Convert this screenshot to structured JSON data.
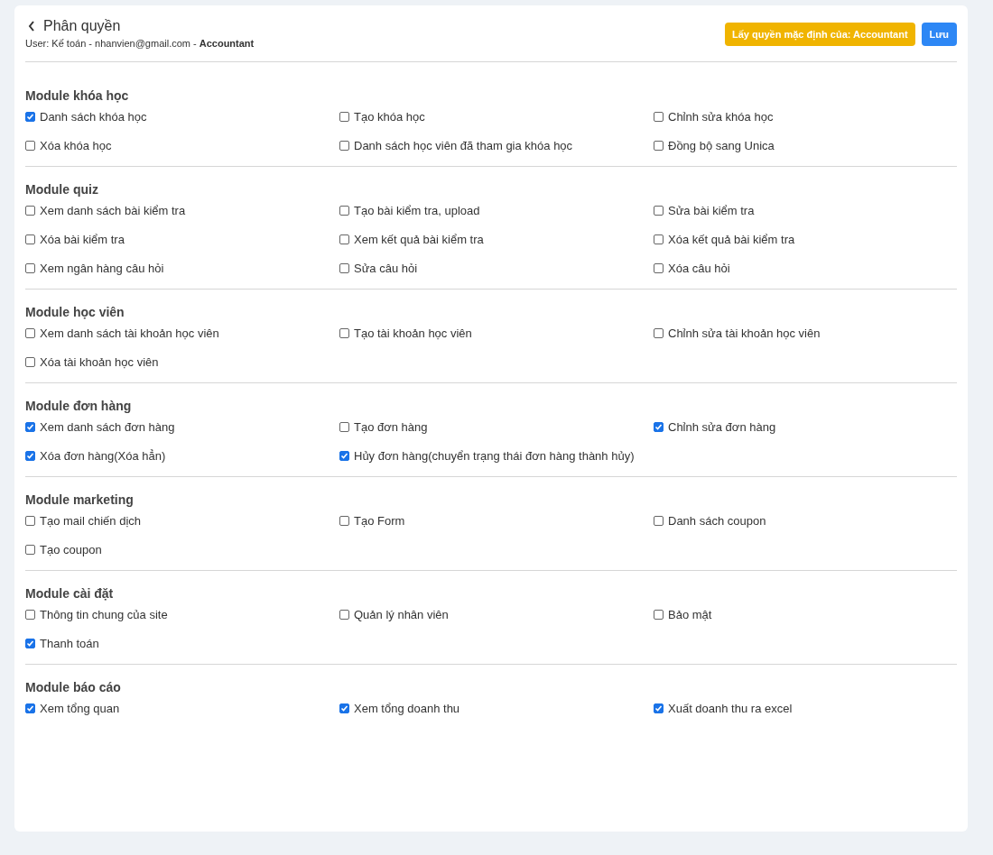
{
  "header": {
    "title": "Phân quyền",
    "subtitle": "User: Kế toán - nhanvien@gmail.com - **Accountant**",
    "buttons": [
      {
        "label": "Lấy quyền mặc định của: Accountant",
        "kind": "warning"
      },
      {
        "label": "Lưu",
        "kind": "primary"
      }
    ]
  },
  "modules": [
    {
      "title": "Module khóa học",
      "permissions": [
        {
          "label": "Danh sách khóa học",
          "checked": true
        },
        {
          "label": "Tạo khóa học",
          "checked": false
        },
        {
          "label": "Chỉnh sửa khóa học",
          "checked": false
        },
        {
          "label": "Xóa khóa học",
          "checked": false
        },
        {
          "label": "Danh sách học viên đã tham gia khóa học",
          "checked": false
        },
        {
          "label": "Đồng bộ sang Unica",
          "checked": false
        }
      ]
    },
    {
      "title": "Module quiz",
      "permissions": [
        {
          "label": "Xem danh sách bài kiểm tra",
          "checked": false
        },
        {
          "label": "Tạo bài kiểm tra, upload",
          "checked": false
        },
        {
          "label": "Sửa bài kiểm tra",
          "checked": false
        },
        {
          "label": "Xóa bài kiểm tra",
          "checked": false
        },
        {
          "label": "Xem kết quả bài kiểm tra",
          "checked": false
        },
        {
          "label": "Xóa kết quả bài kiểm tra",
          "checked": false
        },
        {
          "label": "Xem ngân hàng câu hỏi",
          "checked": false
        },
        {
          "label": "Sửa câu hỏi",
          "checked": false
        },
        {
          "label": "Xóa câu hỏi",
          "checked": false
        }
      ]
    },
    {
      "title": "Module học viên",
      "permissions": [
        {
          "label": "Xem danh sách tài khoản học viên",
          "checked": false
        },
        {
          "label": "Tạo tài khoản học viên",
          "checked": false
        },
        {
          "label": "Chỉnh sửa tài khoản học viên",
          "checked": false
        },
        {
          "label": "Xóa tài khoản học viên",
          "checked": false
        }
      ]
    },
    {
      "title": "Module đơn hàng",
      "permissions": [
        {
          "label": "Xem danh sách đơn hàng",
          "checked": true
        },
        {
          "label": "Tạo đơn hàng",
          "checked": false
        },
        {
          "label": "Chỉnh sửa đơn hàng",
          "checked": true
        },
        {
          "label": "Xóa đơn hàng(Xóa hẳn)",
          "checked": true
        },
        {
          "label": "Hủy đơn hàng(chuyển trạng thái đơn hàng thành hủy)",
          "checked": true
        }
      ]
    },
    {
      "title": "Module marketing",
      "permissions": [
        {
          "label": "Tạo mail chiến dịch",
          "checked": false
        },
        {
          "label": "Tạo Form",
          "checked": false
        },
        {
          "label": "Danh sách coupon",
          "checked": false
        },
        {
          "label": "Tạo coupon",
          "checked": false
        }
      ]
    },
    {
      "title": "Module cài đặt",
      "permissions": [
        {
          "label": "Thông tin chung của site",
          "checked": false
        },
        {
          "label": "Quản lý nhân viên",
          "checked": false
        },
        {
          "label": "Bảo mật",
          "checked": false
        },
        {
          "label": "Thanh toán",
          "checked": true
        }
      ]
    },
    {
      "title": "Module báo cáo",
      "permissions": [
        {
          "label": "Xem tổng quan",
          "checked": true
        },
        {
          "label": "Xem tổng doanh thu",
          "checked": true
        },
        {
          "label": "Xuất doanh thu ra excel",
          "checked": true
        }
      ]
    }
  ]
}
